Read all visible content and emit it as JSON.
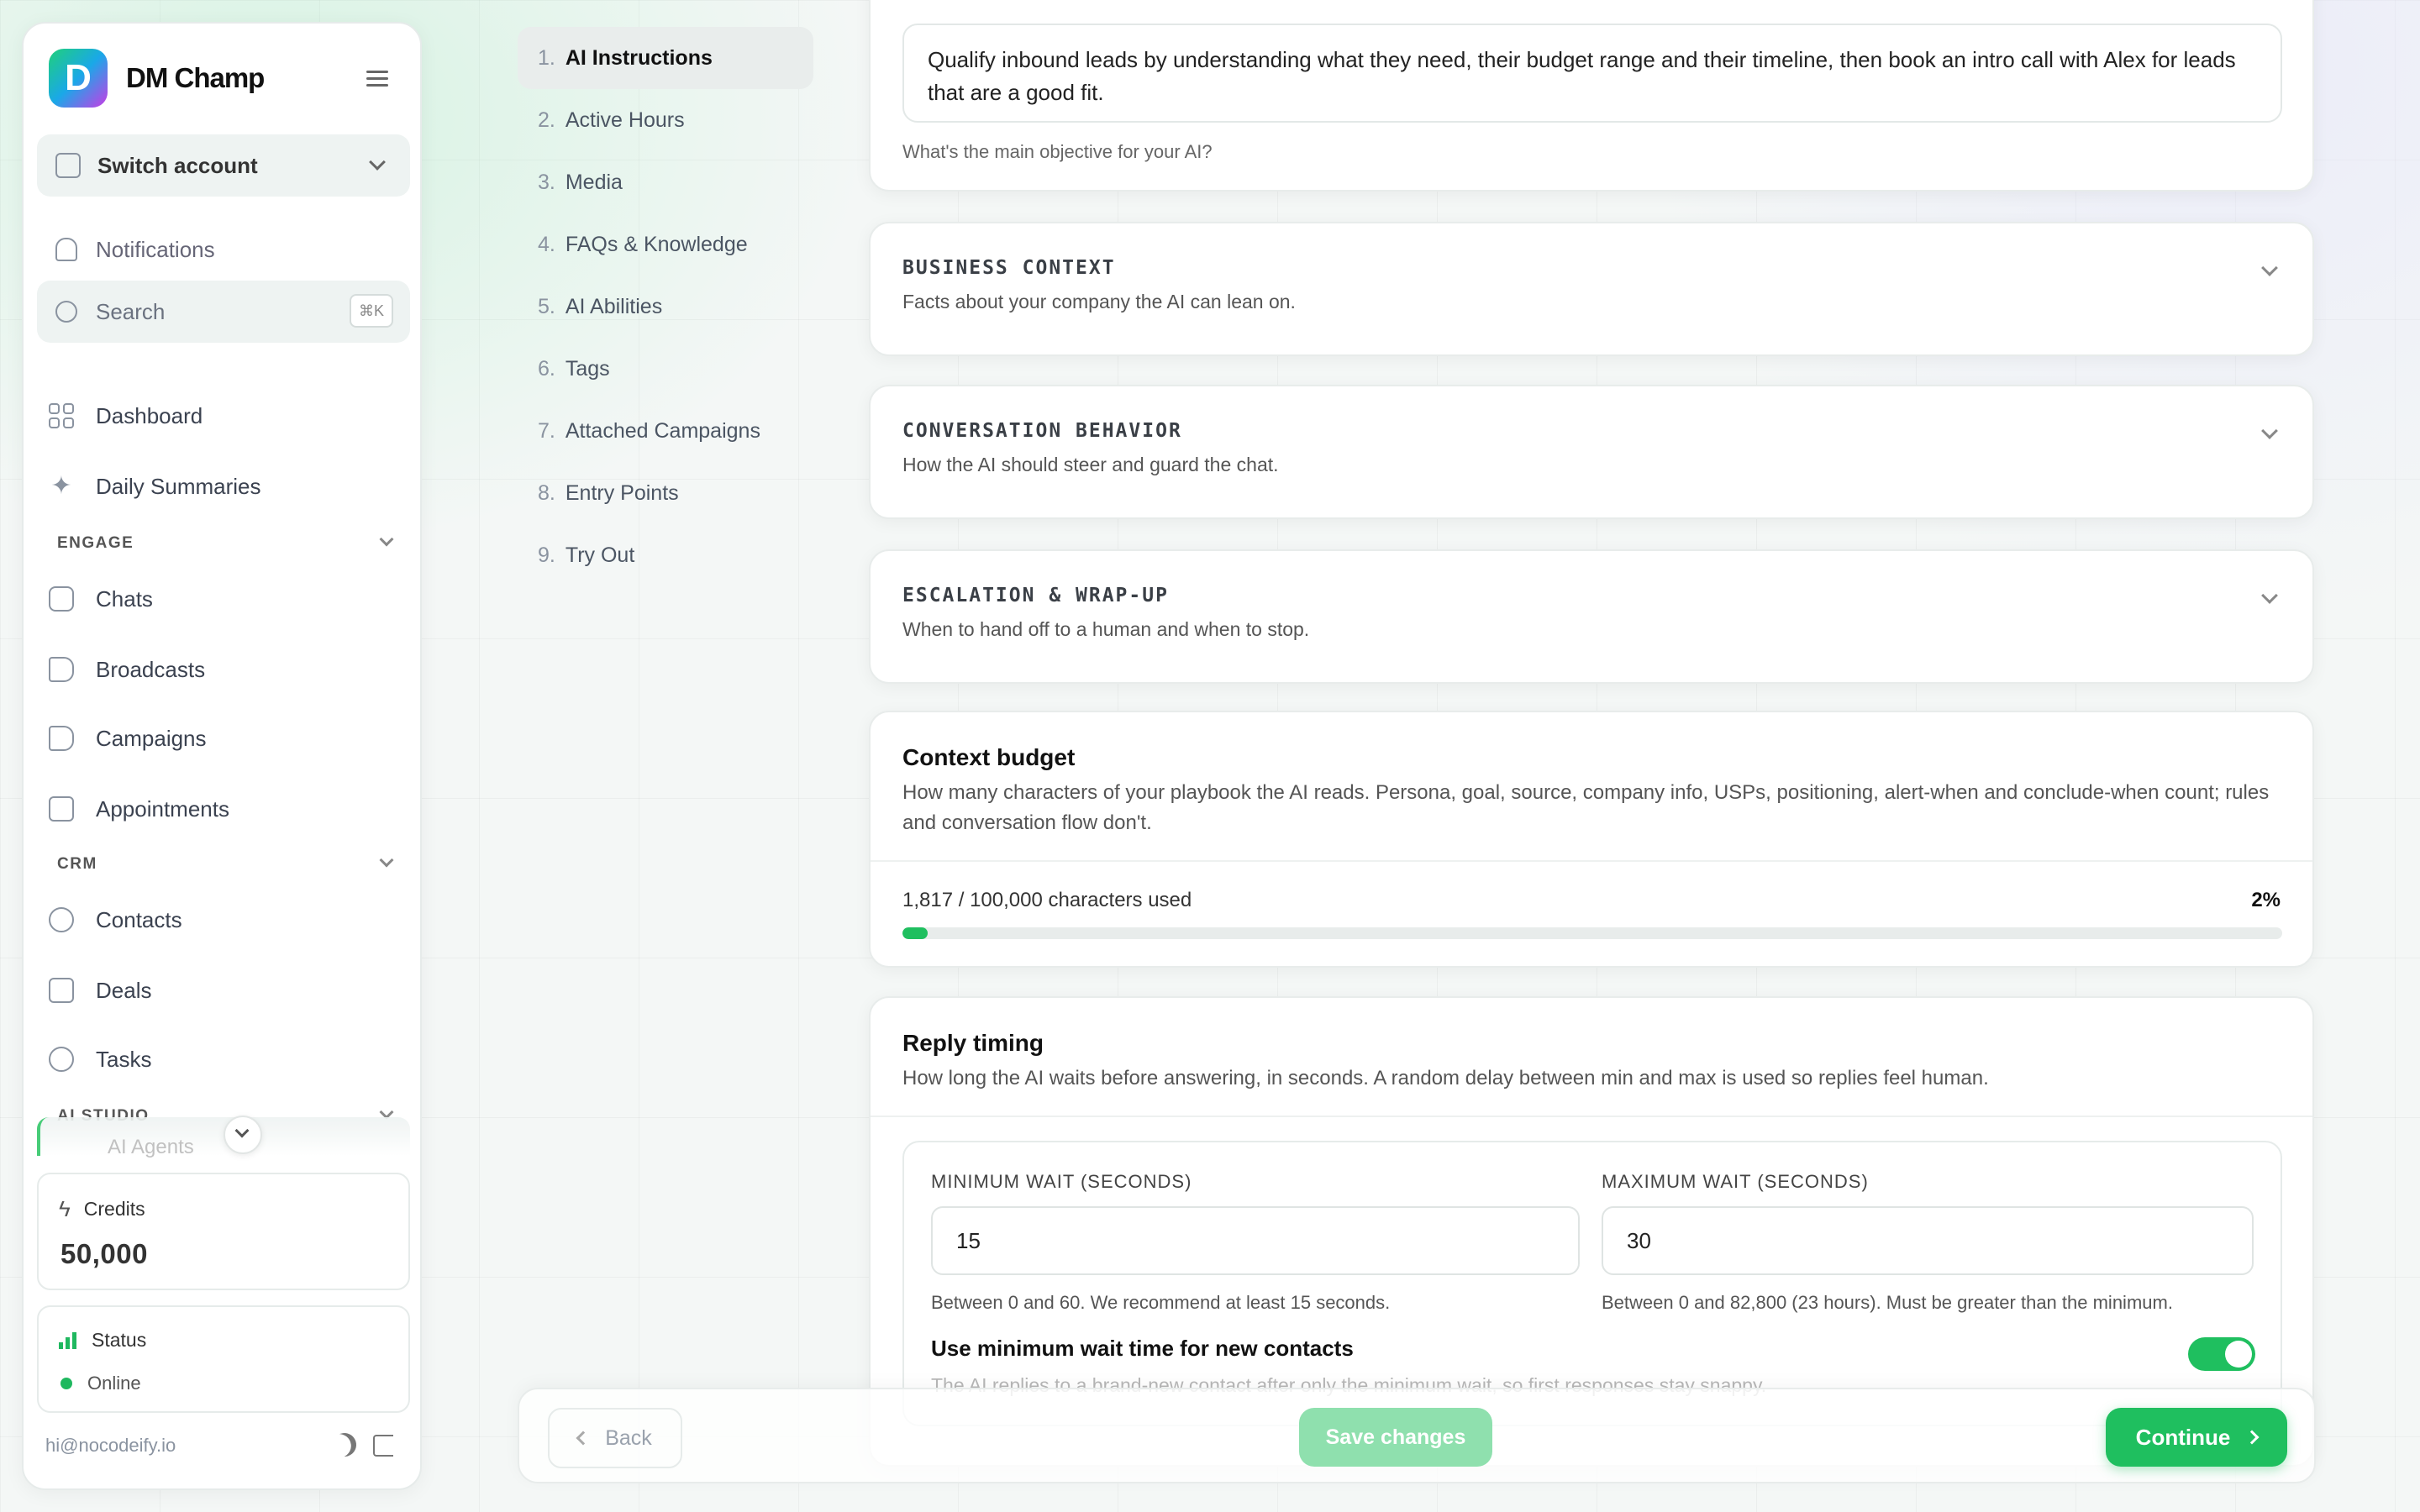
{
  "sidebar": {
    "brand": "DM Champ",
    "logo_letter": "D",
    "switch_account": "Switch account",
    "notifications": "Notifications",
    "search_placeholder": "Search",
    "search_shortcut": "⌘K",
    "dashboard": "Dashboard",
    "daily_summaries": "Daily Summaries",
    "sections": {
      "engage": "ENGAGE",
      "crm": "CRM",
      "ai_studio": "AI STUDIO"
    },
    "engage_items": [
      "Chats",
      "Broadcasts",
      "Campaigns",
      "Appointments"
    ],
    "crm_items": [
      "Contacts",
      "Deals",
      "Tasks"
    ],
    "ai_item_partial": "AI Agents",
    "credits_label": "Credits",
    "credits_value": "50,000",
    "status_label": "Status",
    "status_value": "Online",
    "email": "hi@nocodeify.io"
  },
  "steps": [
    {
      "n": "1.",
      "label": "AI Instructions"
    },
    {
      "n": "2.",
      "label": "Active Hours"
    },
    {
      "n": "3.",
      "label": "Media"
    },
    {
      "n": "4.",
      "label": "FAQs & Knowledge"
    },
    {
      "n": "5.",
      "label": "AI Abilities"
    },
    {
      "n": "6.",
      "label": "Tags"
    },
    {
      "n": "7.",
      "label": "Attached Campaigns"
    },
    {
      "n": "8.",
      "label": "Entry Points"
    },
    {
      "n": "9.",
      "label": "Try Out"
    }
  ],
  "goal": {
    "value": "Qualify inbound leads by understanding what they need, their budget range and their timeline, then book an intro call with Alex for leads that are a good fit.",
    "hint": "What's the main objective for your AI?"
  },
  "accordions": [
    {
      "title": "BUSINESS CONTEXT",
      "desc": "Facts about your company the AI can lean on."
    },
    {
      "title": "CONVERSATION BEHAVIOR",
      "desc": "How the AI should steer and guard the chat."
    },
    {
      "title": "ESCALATION & WRAP-UP",
      "desc": "When to hand off to a human and when to stop."
    }
  ],
  "context_budget": {
    "title": "Context budget",
    "desc": "How many characters of your playbook the AI reads. Persona, goal, source, company info, USPs, positioning, alert-when and conclude-when count; rules and conversation flow don't.",
    "usage": "1,817 / 100,000 characters used",
    "percent": "2%",
    "fraction": 0.018
  },
  "reply_timing": {
    "title": "Reply timing",
    "desc": "How long the AI waits before answering, in seconds. A random delay between min and max is used so replies feel human.",
    "min_label": "MINIMUM WAIT (SECONDS)",
    "min_value": "15",
    "min_hint": "Between 0 and 60. We recommend at least 15 seconds.",
    "max_label": "MAXIMUM WAIT (SECONDS)",
    "max_value": "30",
    "max_hint": "Between 0 and 82,800 (23 hours). Must be greater than the minimum.",
    "toggle_title": "Use minimum wait time for new contacts",
    "toggle_desc": "The AI replies to a brand-new contact after only the minimum wait, so first responses stay snappy.",
    "toggle_on": true
  },
  "footer": {
    "back": "Back",
    "save": "Save changes",
    "continue": "Continue"
  },
  "colors": {
    "accent": "#1fbf5f",
    "accent_light": "#8fe0ae"
  }
}
